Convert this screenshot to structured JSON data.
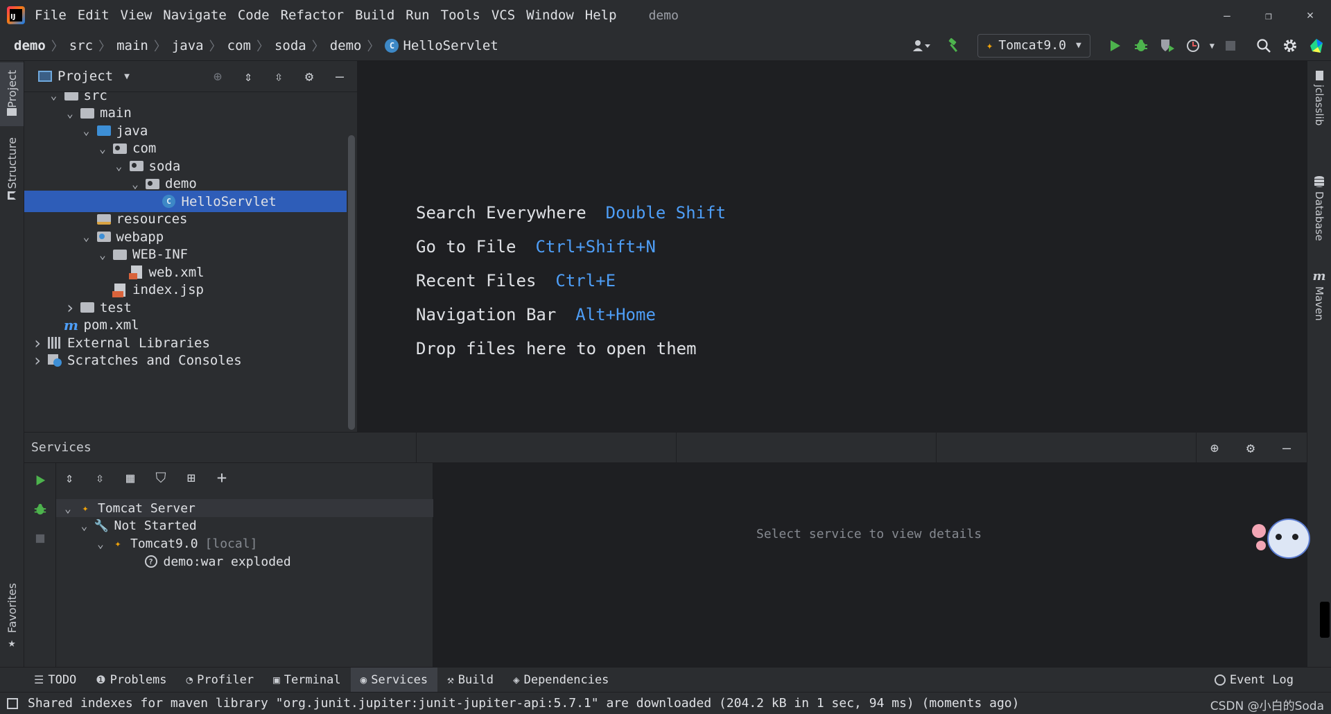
{
  "window": {
    "project_name": "demo",
    "menu": [
      "File",
      "Edit",
      "View",
      "Navigate",
      "Code",
      "Refactor",
      "Build",
      "Run",
      "Tools",
      "VCS",
      "Window",
      "Help"
    ],
    "controls": {
      "minimize": "—",
      "restore": "❐",
      "close": "✕"
    }
  },
  "breadcrumb": [
    "demo",
    "src",
    "main",
    "java",
    "com",
    "soda",
    "demo",
    "HelloServlet"
  ],
  "run_config": {
    "label": "Tomcat9.0"
  },
  "left_strip": {
    "project": "Project",
    "structure": "Structure",
    "favorites": "Favorites"
  },
  "right_strip": {
    "jclasslib": "jclasslib",
    "database": "Database",
    "maven": "Maven"
  },
  "project_panel": {
    "title": "Project",
    "tree": [
      {
        "label": "src",
        "depth": 1,
        "chevron": "open",
        "icon": "folder"
      },
      {
        "label": "main",
        "depth": 2,
        "chevron": "open",
        "icon": "folder"
      },
      {
        "label": "java",
        "depth": 3,
        "chevron": "open",
        "icon": "source-folder"
      },
      {
        "label": "com",
        "depth": 4,
        "chevron": "open",
        "icon": "package"
      },
      {
        "label": "soda",
        "depth": 5,
        "chevron": "open",
        "icon": "package"
      },
      {
        "label": "demo",
        "depth": 6,
        "chevron": "open",
        "icon": "package"
      },
      {
        "label": "HelloServlet",
        "depth": 7,
        "chevron": "none",
        "icon": "class",
        "selected": true
      },
      {
        "label": "resources",
        "depth": 3,
        "chevron": "none",
        "icon": "resources-folder"
      },
      {
        "label": "webapp",
        "depth": 3,
        "chevron": "open",
        "icon": "web-folder"
      },
      {
        "label": "WEB-INF",
        "depth": 4,
        "chevron": "open",
        "icon": "folder"
      },
      {
        "label": "web.xml",
        "depth": 5,
        "chevron": "none",
        "icon": "xml-file"
      },
      {
        "label": "index.jsp",
        "depth": 4,
        "chevron": "none",
        "icon": "jsp-file"
      },
      {
        "label": "test",
        "depth": 2,
        "chevron": "closed",
        "icon": "folder"
      },
      {
        "label": "pom.xml",
        "depth": 1,
        "chevron": "none",
        "icon": "maven-file"
      },
      {
        "label": "External Libraries",
        "depth": 0,
        "chevron": "closed",
        "icon": "libraries"
      },
      {
        "label": "Scratches and Consoles",
        "depth": 0,
        "chevron": "closed",
        "icon": "scratches"
      }
    ]
  },
  "editor_hints": [
    {
      "label": "Search Everywhere",
      "key": "Double Shift"
    },
    {
      "label": "Go to File",
      "key": "Ctrl+Shift+N"
    },
    {
      "label": "Recent Files",
      "key": "Ctrl+E"
    },
    {
      "label": "Navigation Bar",
      "key": "Alt+Home"
    },
    {
      "label": "Drop files here to open them",
      "key": ""
    }
  ],
  "services": {
    "title": "Services",
    "empty_text": "Select service to view details",
    "tree": [
      {
        "label": "Tomcat Server",
        "suffix": "",
        "depth": 0
      },
      {
        "label": "Not Started",
        "suffix": "",
        "depth": 1
      },
      {
        "label": "Tomcat9.0",
        "suffix": "[local]",
        "depth": 2
      },
      {
        "label": "demo:war exploded",
        "suffix": "",
        "depth": 3
      }
    ]
  },
  "bottom_tabs": [
    {
      "label": "TODO",
      "icon": "list-icon"
    },
    {
      "label": "Problems",
      "icon": "problems-icon"
    },
    {
      "label": "Profiler",
      "icon": "profiler-icon"
    },
    {
      "label": "Terminal",
      "icon": "terminal-icon"
    },
    {
      "label": "Services",
      "icon": "services-icon",
      "active": true
    },
    {
      "label": "Build",
      "icon": "hammer-icon"
    },
    {
      "label": "Dependencies",
      "icon": "dependencies-icon"
    }
  ],
  "event_log": "Event Log",
  "status_message": "Shared indexes for maven library \"org.junit.jupiter:junit-jupiter-api:5.7.1\" are downloaded (204.2 kB in 1 sec, 94 ms) (moments ago)",
  "watermark": "CSDN @小白的Soda",
  "colors": {
    "background": "#1e1f22",
    "panel": "#2b2d30",
    "selection": "#2e5db8",
    "shortcut": "#4e9ef7",
    "run_green": "#4db34d"
  }
}
